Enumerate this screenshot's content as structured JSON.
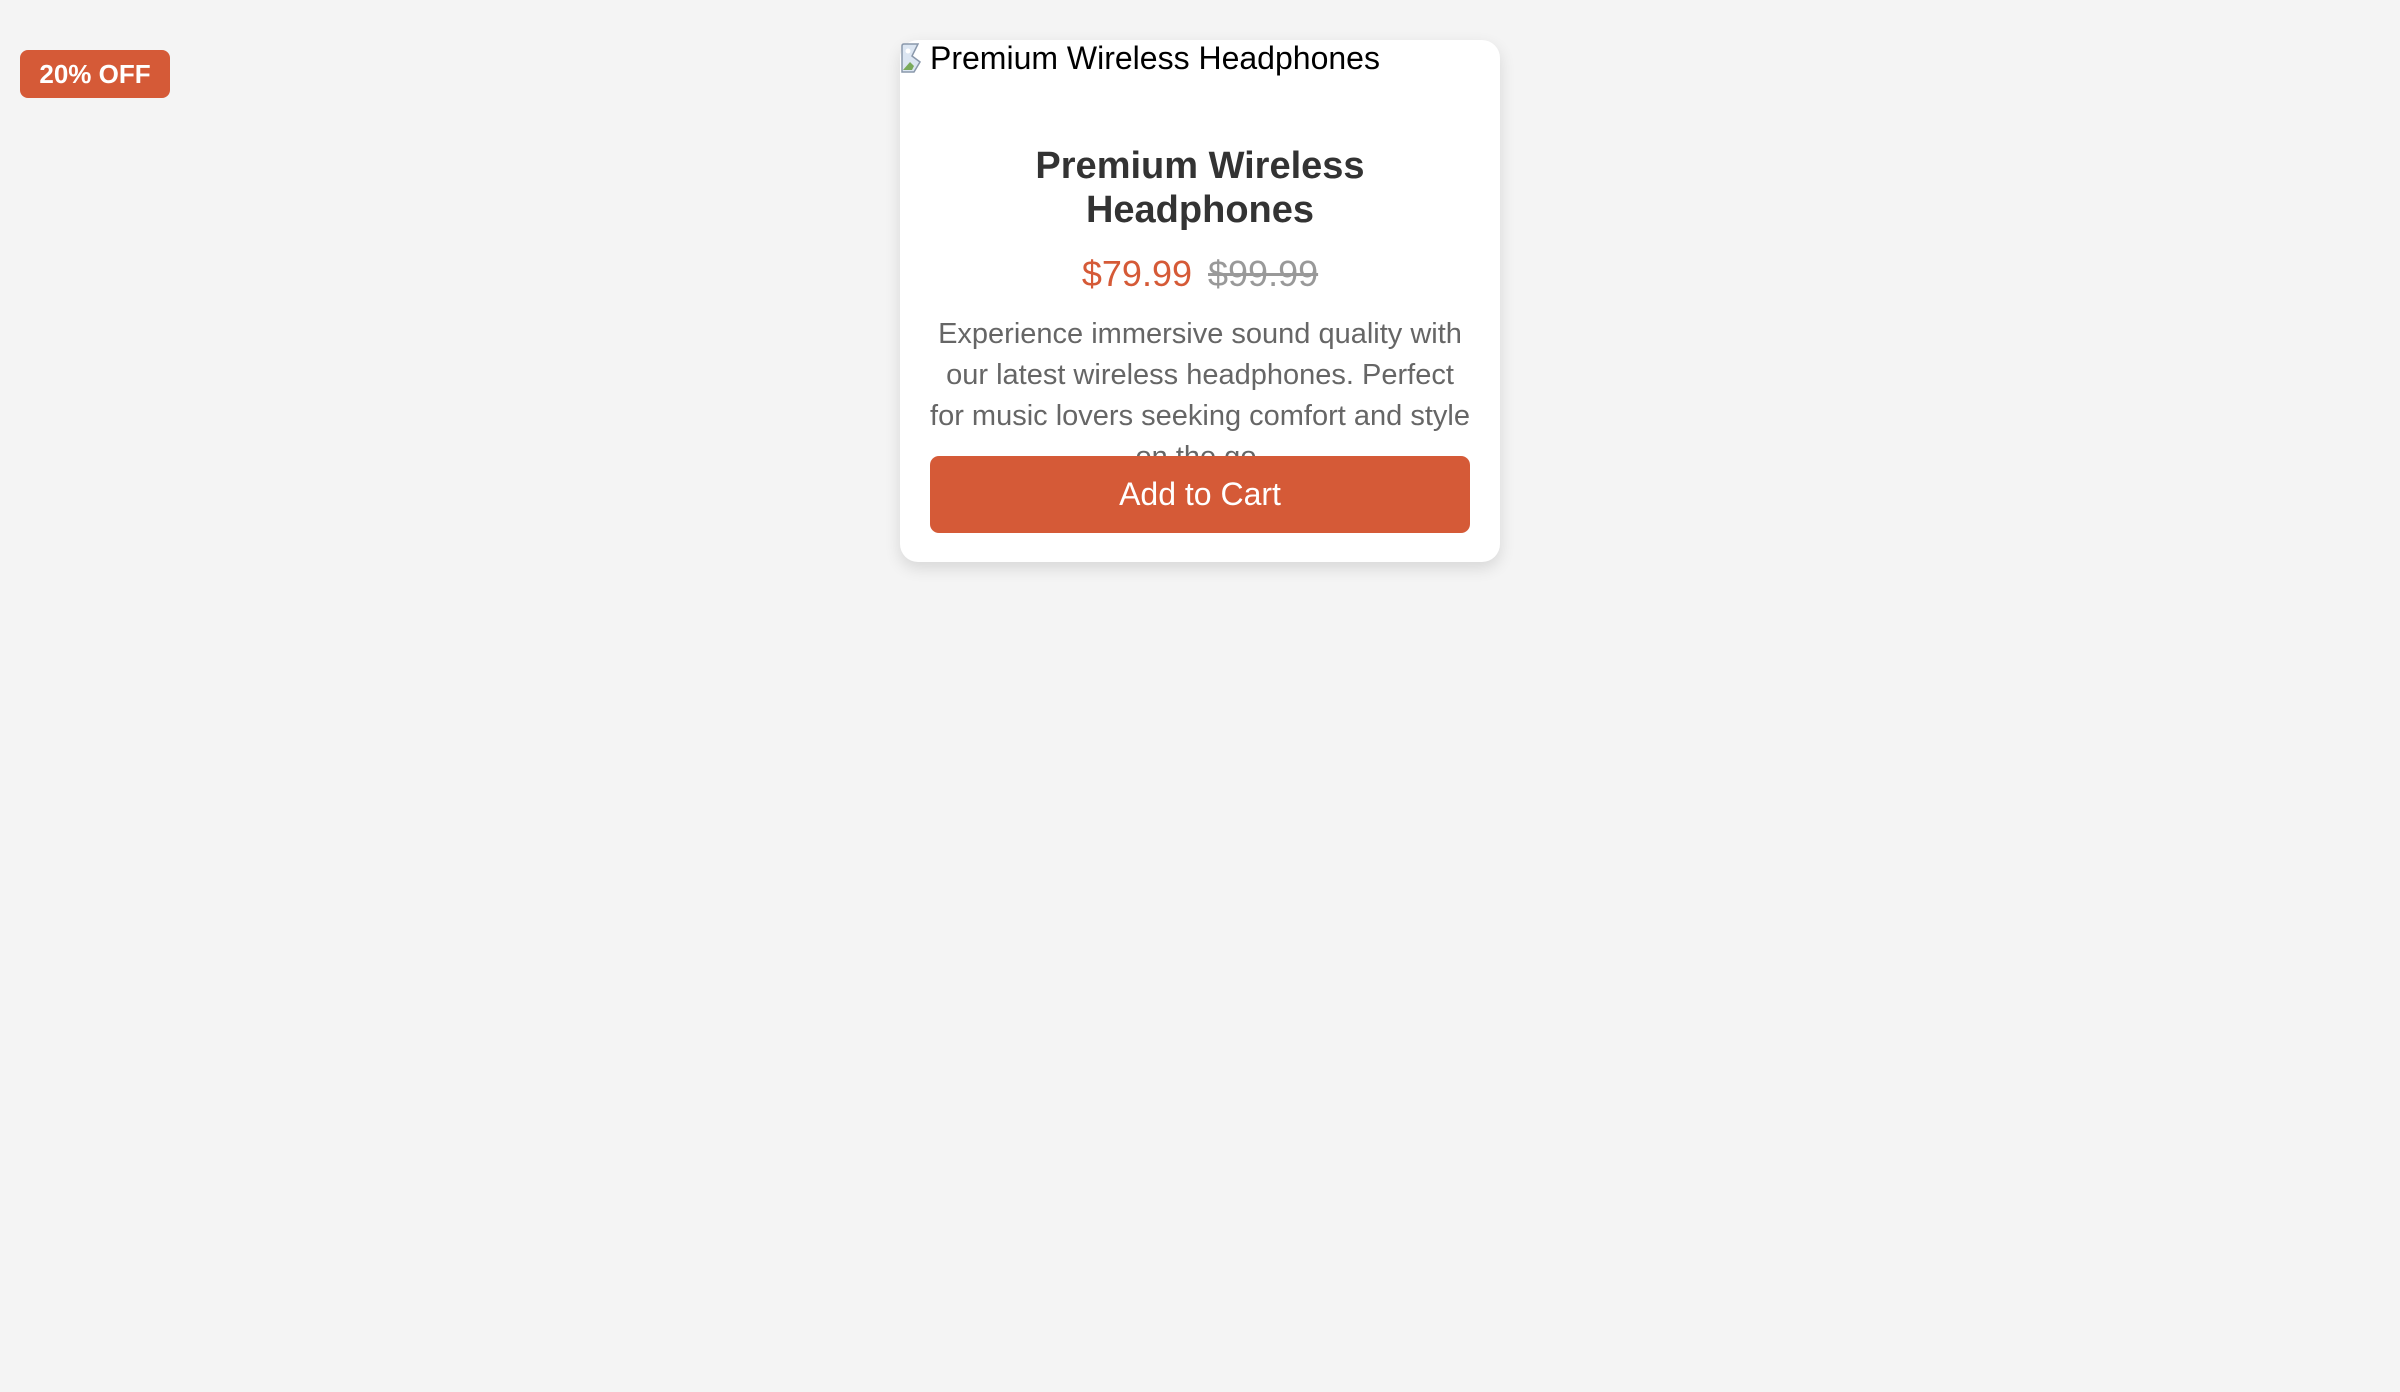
{
  "badge": {
    "label": "20% OFF"
  },
  "product": {
    "image_alt": "Premium Wireless Headphones",
    "image_icon": "broken-image-icon",
    "title": "Premium Wireless Headphones",
    "price_current": "$79.99",
    "price_original": "$99.99",
    "description": "Experience immersive sound quality with our latest wireless headphones. Perfect for music lovers seeking comfort and style on the go.",
    "cta_label": "Add to Cart"
  },
  "colors": {
    "accent": "#d55a37",
    "page_background": "#f4f4f4",
    "card_background": "#ffffff",
    "title_text": "#333333",
    "body_text": "#666666",
    "strikethrough_text": "#999999"
  }
}
